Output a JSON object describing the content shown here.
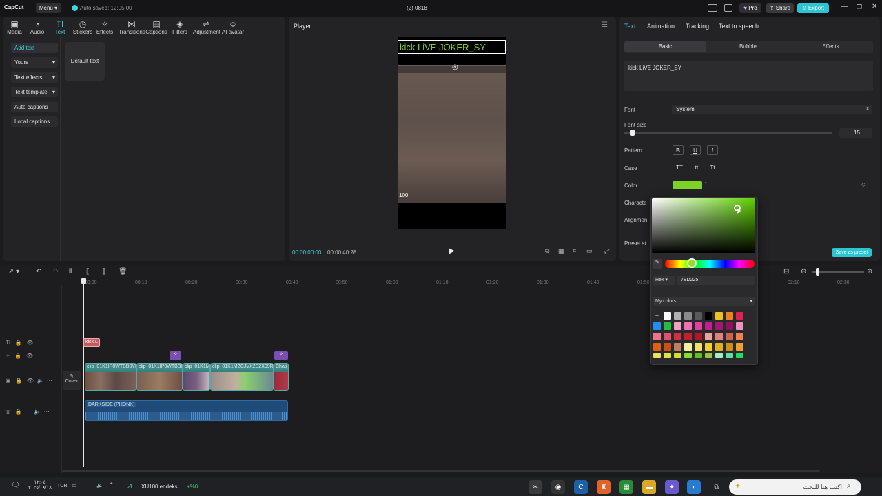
{
  "titlebar": {
    "app_name": "CapCut",
    "menu_label": "Menu",
    "autosave": "Auto saved: 12:05:00",
    "project_name": "(2) 0818",
    "pro_label": "Pro",
    "share_label": "Share",
    "export_label": "Export"
  },
  "tools": [
    {
      "label": "Media",
      "icon": "media-icon"
    },
    {
      "label": "Audio",
      "icon": "audio-icon"
    },
    {
      "label": "Text",
      "icon": "text-icon"
    },
    {
      "label": "Stickers",
      "icon": "stickers-icon"
    },
    {
      "label": "Effects",
      "icon": "effects-icon"
    },
    {
      "label": "Transitions",
      "icon": "transitions-icon"
    },
    {
      "label": "Captions",
      "icon": "captions-icon"
    },
    {
      "label": "Filters",
      "icon": "filters-icon"
    },
    {
      "label": "Adjustment",
      "icon": "adjustment-icon"
    },
    {
      "label": "AI avatar",
      "icon": "ai-avatar-icon"
    }
  ],
  "sidebar": {
    "items": [
      "Add text",
      "Yours",
      "Text effects",
      "Text template",
      "Auto captions",
      "Local captions"
    ],
    "default_text_card": "Default text"
  },
  "player": {
    "title": "Player",
    "overlay_text": "kick LiVE JOKER_SY",
    "hud_number": "100",
    "current_time": "00:00:00:00",
    "duration": "00:00:40:28"
  },
  "props": {
    "tabs": [
      "Text",
      "Animation",
      "Tracking",
      "Text to speech"
    ],
    "segments": [
      "Basic",
      "Bubble",
      "Effects"
    ],
    "text_value": "kick LiVE JOKER_SY",
    "font_label": "Font",
    "font_value": "System",
    "font_size_label": "Font size",
    "font_size_value": "15",
    "pattern_label": "Pattern",
    "pattern_buttons": [
      "B",
      "U",
      "I"
    ],
    "case_label": "Case",
    "case_buttons": [
      "TT",
      "tt",
      "Tt"
    ],
    "color_label": "Color",
    "color_value": "#7ED225",
    "character_label": "Characte",
    "alignment_label": "Alignmen",
    "preset_label": "Preset st",
    "save_preset_label": "Save as preset"
  },
  "picker": {
    "hex_label": "Hex",
    "hex_value": "7ED225",
    "my_colors_label": "My colors",
    "add_symbol": "+"
  },
  "timeline": {
    "ticks": [
      "00:00",
      "00:10",
      "00:20",
      "00:30",
      "00:40",
      "00:50",
      "01:00",
      "01:10",
      "01:20",
      "01:30",
      "01:40",
      "01:50",
      "02:00",
      "02:10",
      "02:20",
      "02:30"
    ],
    "text_clip": "kick L",
    "cover_label": "Cover",
    "clips": [
      "clip_01K1IP0WTBB0YB3",
      "clip_01K1IP0WTBB0Y",
      "clip_01K1MZ",
      "clip_01K1MZCJVX2S2X99RX",
      "Chat("
    ],
    "audio_label": "DARKSIDE  (PHONK)"
  },
  "taskbar": {
    "time": "١٢:٠٥",
    "date": "٢٠٢٥/٠٨/١٨",
    "lang": "TUR",
    "stock_name": "XU100 endeksi",
    "stock_change": "+%0...",
    "search_placeholder": "اكتب هنا للبحث"
  }
}
